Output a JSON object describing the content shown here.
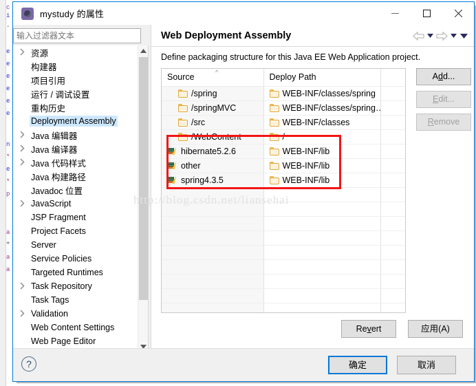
{
  "window": {
    "title": "mystudy 的属性",
    "icon": "properties-gear-icon",
    "minimize_label": "最小化",
    "maximize_label": "最大化",
    "close_label": "关闭"
  },
  "filter": {
    "placeholder": "输入过滤器文本",
    "value": ""
  },
  "sidebar": {
    "items": [
      {
        "label": "资源",
        "expandable": true,
        "selected": false
      },
      {
        "label": "构建器",
        "expandable": false,
        "selected": false
      },
      {
        "label": "项目引用",
        "expandable": false,
        "selected": false
      },
      {
        "label": "运行 / 调试设置",
        "expandable": false,
        "selected": false
      },
      {
        "label": "重构历史",
        "expandable": false,
        "selected": false
      },
      {
        "label": "Deployment Assembly",
        "expandable": false,
        "selected": true
      },
      {
        "label": "Java 编辑器",
        "expandable": true,
        "selected": false
      },
      {
        "label": "Java 编译器",
        "expandable": true,
        "selected": false
      },
      {
        "label": "Java 代码样式",
        "expandable": true,
        "selected": false
      },
      {
        "label": "Java 构建路径",
        "expandable": false,
        "selected": false
      },
      {
        "label": "Javadoc 位置",
        "expandable": false,
        "selected": false
      },
      {
        "label": "JavaScript",
        "expandable": true,
        "selected": false
      },
      {
        "label": "JSP Fragment",
        "expandable": false,
        "selected": false
      },
      {
        "label": "Project Facets",
        "expandable": false,
        "selected": false
      },
      {
        "label": "Server",
        "expandable": false,
        "selected": false
      },
      {
        "label": "Service Policies",
        "expandable": false,
        "selected": false
      },
      {
        "label": "Targeted Runtimes",
        "expandable": false,
        "selected": false
      },
      {
        "label": "Task Repository",
        "expandable": true,
        "selected": false
      },
      {
        "label": "Task Tags",
        "expandable": false,
        "selected": false
      },
      {
        "label": "Validation",
        "expandable": true,
        "selected": false
      },
      {
        "label": "Web Content Settings",
        "expandable": false,
        "selected": false
      },
      {
        "label": "Web Page Editor",
        "expandable": false,
        "selected": false
      }
    ]
  },
  "page": {
    "title": "Web Deployment Assembly",
    "description": "Define packaging structure for this Java EE Web Application project.",
    "nav": {
      "back_icon": "arrow-left-icon",
      "back_menu_icon": "caret-down-icon",
      "forward_icon": "arrow-right-icon",
      "forward_menu_icon": "caret-down-icon",
      "view_menu_icon": "caret-down-icon"
    }
  },
  "table": {
    "sort_indicator": "^",
    "sort_column": "Source",
    "columns": [
      "Source",
      "Deploy Path",
      ""
    ],
    "rows": [
      {
        "source": "/spring",
        "source_icon": "folder-icon",
        "deploy": "WEB-INF/classes/spring",
        "deploy_icon": "folder-icon",
        "highlighted": false
      },
      {
        "source": "/springMVC",
        "source_icon": "folder-icon",
        "deploy": "WEB-INF/classes/spring…",
        "deploy_icon": "folder-icon",
        "highlighted": false
      },
      {
        "source": "/src",
        "source_icon": "folder-icon",
        "deploy": "WEB-INF/classes",
        "deploy_icon": "folder-icon",
        "highlighted": false
      },
      {
        "source": "/WebContent",
        "source_icon": "folder-icon",
        "deploy": "/",
        "deploy_icon": "folder-icon",
        "highlighted": false
      },
      {
        "source": "hibernate5.2.6",
        "source_icon": "library-icon",
        "deploy": "WEB-INF/lib",
        "deploy_icon": "folder-icon",
        "highlighted": true
      },
      {
        "source": "other",
        "source_icon": "library-icon",
        "deploy": "WEB-INF/lib",
        "deploy_icon": "folder-icon",
        "highlighted": true
      },
      {
        "source": "spring4.3.5",
        "source_icon": "library-icon",
        "deploy": "WEB-INF/lib",
        "deploy_icon": "folder-icon",
        "highlighted": true
      }
    ],
    "empty_row_count": 9
  },
  "side_buttons": [
    {
      "label": "Add...",
      "mnemonic": "d",
      "enabled": true
    },
    {
      "label": "Edit...",
      "mnemonic": "E",
      "enabled": false
    },
    {
      "label": "Remove",
      "mnemonic": "R",
      "enabled": false
    }
  ],
  "panel_buttons": {
    "revert": "Revert",
    "apply": "应用(A)"
  },
  "footer": {
    "help_label": "?",
    "ok": "确定",
    "cancel": "取消"
  },
  "watermark": "http://blog.csdn.net/liansehai",
  "colors": {
    "accent": "#0078d7",
    "selection": "#cde8ff",
    "highlight_box": "#f41414",
    "folder": "#e0a93f",
    "dialog_bg": "#f0f0f0"
  }
}
